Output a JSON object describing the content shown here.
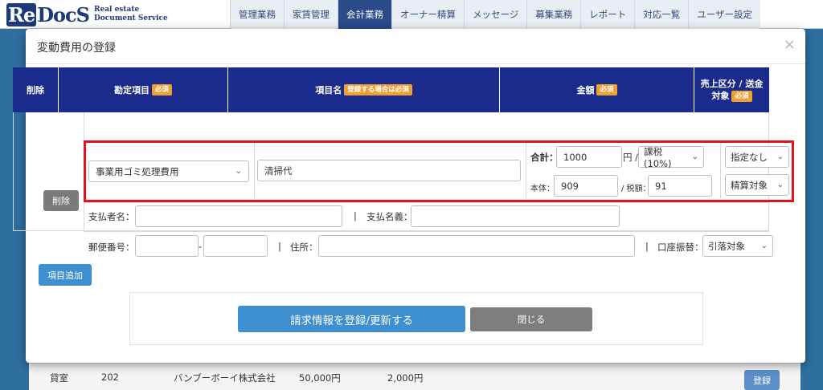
{
  "app": {
    "logo_mark": "ReDocS",
    "logo_re": "Re",
    "logo_rest": "DocS",
    "logo_sub": "Real estate\nDocument Service"
  },
  "nav": {
    "items": [
      "管理業務",
      "家賃管理",
      "会計業務",
      "オーナー精算",
      "メッセージ",
      "募集業務",
      "レポート",
      "対応一覧",
      "ユーザー設定"
    ],
    "active": "会計業務"
  },
  "background_row": {
    "type": "貸室",
    "room": "202",
    "tenant": "バンブーボーイ株式会社",
    "amount1": "50,000円",
    "amount2": "2,000円",
    "button": "登録"
  },
  "modal": {
    "title": "変動費用の登録",
    "close_icon": "×",
    "table": {
      "headers": {
        "delete": "削除",
        "account": "勘定項目",
        "item_name": "項目名",
        "amount": "金額",
        "sales": "売上区分 / 送金対象"
      },
      "badges": {
        "required": "必須",
        "required_if_register": "登録する場合は必須"
      },
      "row": {
        "delete_button": "削除",
        "account_value": "事業用ゴミ処理費用",
        "item_name_value": "清掃代",
        "total_label": "合計：",
        "total_value": "1000",
        "yen_slash": "円 /",
        "tax_type": "課税(10%)",
        "base_label": "本体：",
        "base_value": "909",
        "tax_label": "/ 税額：",
        "tax_value": "91",
        "sales_type": "指定なし",
        "settlement_target": "精算対象"
      },
      "payer": {
        "name_label": "支払者名：",
        "name_value": "",
        "divider": "|",
        "account_name_label": "支払名義：",
        "account_name_value": ""
      },
      "address": {
        "zip_label": "郵便番号：",
        "zip1": "",
        "dash": "-",
        "zip2": "",
        "divider": "|",
        "address_label": "住所：",
        "address_value": "",
        "divider2": "|",
        "transfer_label": "口座振替：",
        "transfer_value": "引落対象"
      }
    },
    "add_item_button": "項目追加",
    "submit_button": "請求情報を登録/更新する",
    "close_button": "閉じる"
  },
  "colors": {
    "header_navy": "#1b2b8c",
    "badge_orange": "#f0a030",
    "primary_blue": "#3d8fd0",
    "highlight_red": "#e0121e"
  }
}
